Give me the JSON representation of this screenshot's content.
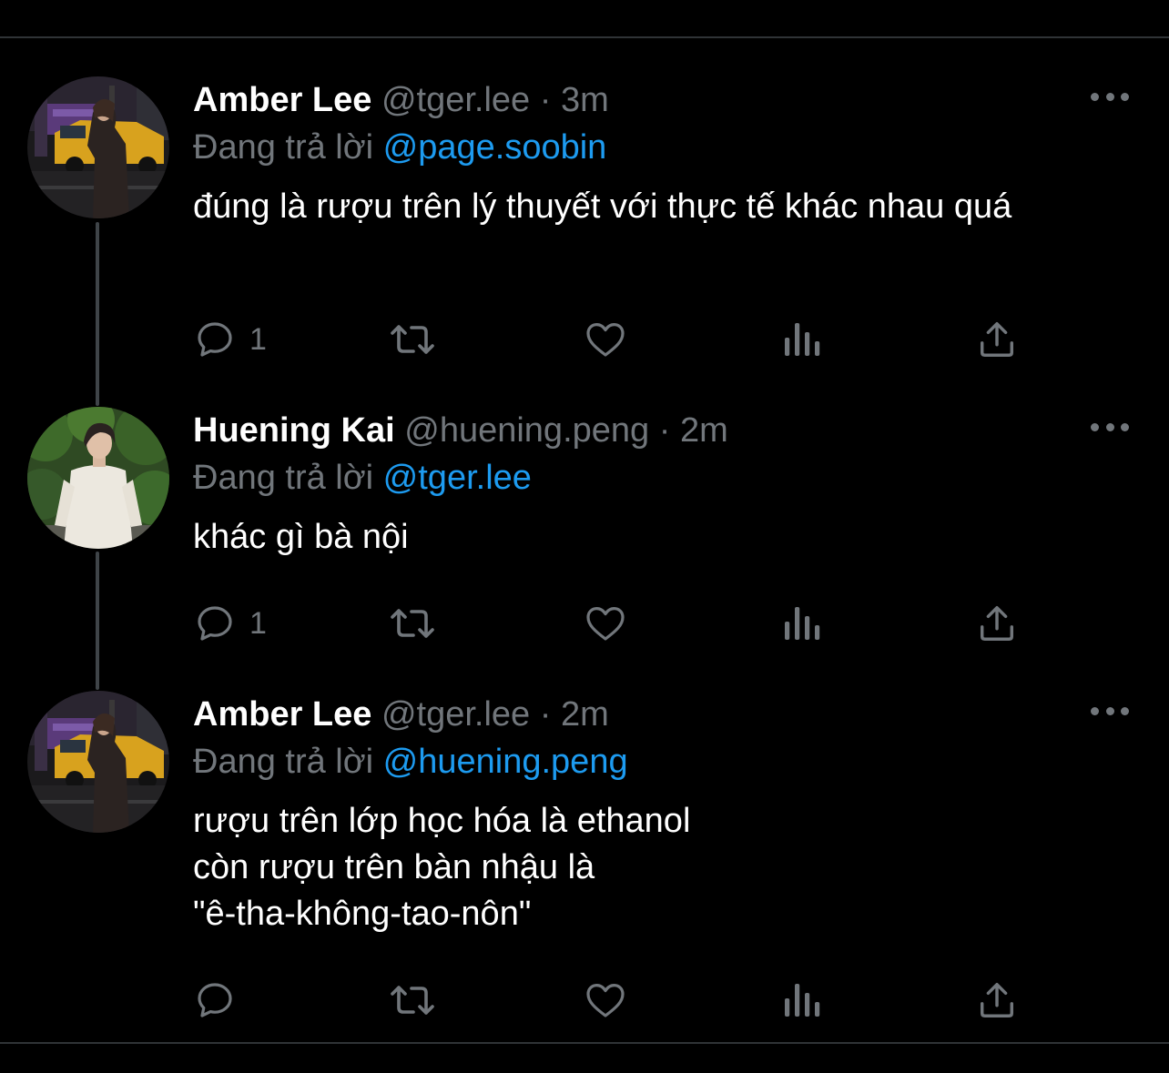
{
  "colors": {
    "background": "#000000",
    "text": "#ffffff",
    "muted": "#71767b",
    "accent": "#1d9bf0",
    "divider": "#2f3336"
  },
  "tweets": [
    {
      "display_name": "Amber Lee",
      "handle": "@tger.lee",
      "separator": "·",
      "time": "3m",
      "reply_prefix": "Đang trả lời",
      "reply_to": "@page.soobin",
      "text": "đúng là rượu trên lý thuyết với thực tế khác nhau quá",
      "reply_count": "1",
      "avatar_icon": "profile-photo"
    },
    {
      "display_name": "Huening Kai",
      "handle": "@huening.peng",
      "separator": "·",
      "time": "2m",
      "reply_prefix": "Đang trả lời",
      "reply_to": "@tger.lee",
      "text": "khác gì bà nội",
      "reply_count": "1",
      "avatar_icon": "profile-photo"
    },
    {
      "display_name": "Amber Lee",
      "handle": "@tger.lee",
      "separator": "·",
      "time": "2m",
      "reply_prefix": "Đang trả lời",
      "reply_to": "@huening.peng",
      "text": "rượu trên lớp học hóa là ethanol\ncòn rượu trên bàn nhậu là\n\"ê-tha-không-tao-nôn\"",
      "reply_count": "",
      "avatar_icon": "profile-photo"
    }
  ],
  "action_icons": [
    "reply-icon",
    "retweet-icon",
    "like-icon",
    "views-icon",
    "share-icon"
  ]
}
